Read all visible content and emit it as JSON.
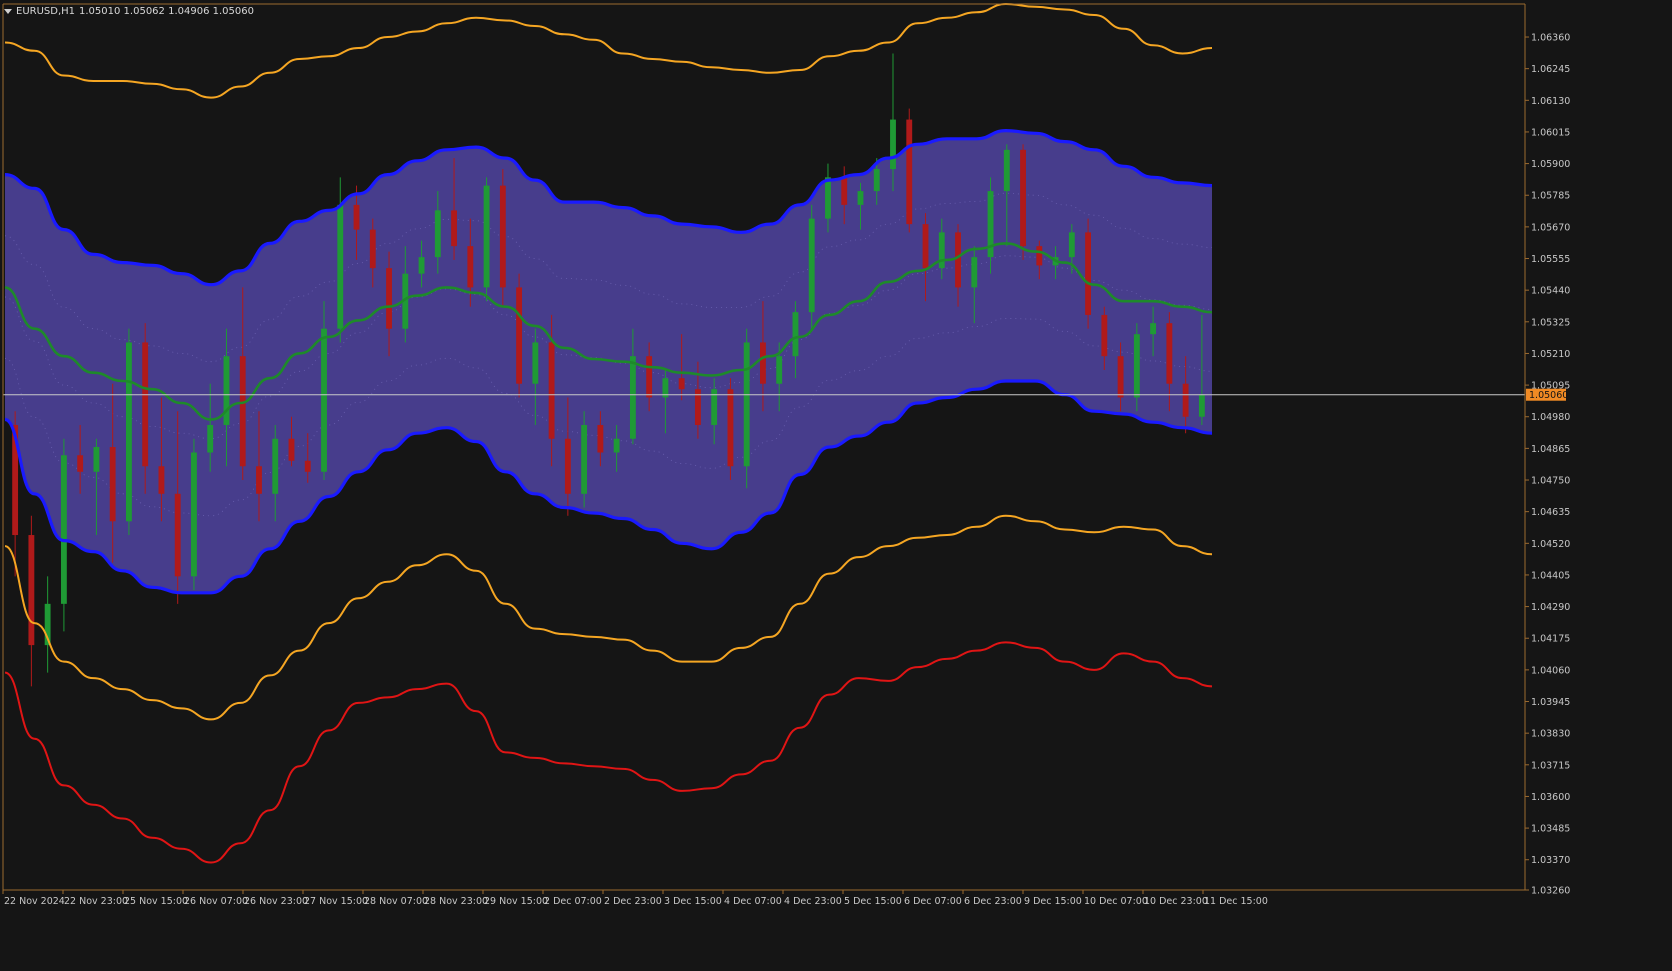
{
  "window": {
    "symbol_title": "EURUSD,H1",
    "ohlc": "1.05010 1.05062 1.04906 1.05060",
    "menu_icon": "triangle-down-icon"
  },
  "colors": {
    "background": "#151515",
    "band_fill": "#473d8c",
    "band_edge": "#1a1aff",
    "middle_line": "#1e8a2a",
    "outer_upper": "#f5a623",
    "lower_orange": "#f5a623",
    "lower_red": "#e01515",
    "bull_candle": "#1f9a35",
    "bear_candle": "#b01a1a",
    "price_line": "#c9c9c9",
    "axis": "#9c6a2f",
    "price_tag": "#f08a24"
  },
  "current_price": "1.05060",
  "chart_data": {
    "type": "line",
    "title": "EURUSD,H1",
    "ylim": [
      1.0326,
      1.0648
    ],
    "y_ticks": [
      "1.06360",
      "1.06245",
      "1.06130",
      "1.06015",
      "1.05900",
      "1.05785",
      "1.05670",
      "1.05555",
      "1.05440",
      "1.05325",
      "1.05210",
      "1.05095",
      "1.04980",
      "1.04865",
      "1.04750",
      "1.04635",
      "1.04520",
      "1.04405",
      "1.04290",
      "1.04175",
      "1.04060",
      "1.03945",
      "1.03830",
      "1.03715",
      "1.03600",
      "1.03485",
      "1.03370",
      "1.03260"
    ],
    "x_ticks": [
      "22 Nov 2024",
      "22 Nov 23:00",
      "25 Nov 15:00",
      "26 Nov 07:00",
      "26 Nov 23:00",
      "27 Nov 15:00",
      "28 Nov 07:00",
      "28 Nov 23:00",
      "29 Nov 15:00",
      "2 Dec 07:00",
      "2 Dec 23:00",
      "3 Dec 15:00",
      "4 Dec 07:00",
      "4 Dec 23:00",
      "5 Dec 15:00",
      "6 Dec 07:00",
      "6 Dec 23:00",
      "9 Dec 15:00",
      "10 Dec 07:00",
      "10 Dec 23:00",
      "11 Dec 15:00"
    ],
    "series": [
      {
        "role": "outer-upper",
        "values": [
          1.0634,
          1.0631,
          1.0622,
          1.062,
          1.062,
          1.0619,
          1.0617,
          1.0614,
          1.0618,
          1.0623,
          1.0628,
          1.0629,
          1.0632,
          1.0636,
          1.0638,
          1.0641,
          1.0643,
          1.0642,
          1.064,
          1.0637,
          1.0635,
          1.063,
          1.0628,
          1.0627,
          1.0625,
          1.0624,
          1.0623,
          1.0624,
          1.0629,
          1.0631,
          1.0634,
          1.0641,
          1.0643,
          1.0645,
          1.0648,
          1.0647,
          1.0646,
          1.0644,
          1.0639,
          1.0633,
          1.063,
          1.0632
        ]
      },
      {
        "role": "band-upper",
        "values": [
          1.0586,
          1.0581,
          1.0566,
          1.0557,
          1.0554,
          1.0553,
          1.055,
          1.0546,
          1.0551,
          1.0561,
          1.0569,
          1.0573,
          1.0579,
          1.0586,
          1.0591,
          1.0595,
          1.0596,
          1.0592,
          1.0584,
          1.0576,
          1.0576,
          1.0574,
          1.0571,
          1.0568,
          1.0567,
          1.0565,
          1.0568,
          1.0575,
          1.0584,
          1.0586,
          1.0592,
          1.0597,
          1.0599,
          1.0599,
          1.0602,
          1.0601,
          1.0598,
          1.0595,
          1.0589,
          1.0585,
          1.0583,
          1.0582
        ]
      },
      {
        "role": "middle",
        "values": [
          1.0545,
          1.053,
          1.052,
          1.0514,
          1.0511,
          1.0508,
          1.0503,
          1.0497,
          1.0503,
          1.0512,
          1.0521,
          1.0527,
          1.0533,
          1.0538,
          1.0542,
          1.0545,
          1.0543,
          1.0538,
          1.0531,
          1.0523,
          1.0519,
          1.0518,
          1.0516,
          1.0514,
          1.0513,
          1.0515,
          1.052,
          1.0527,
          1.0535,
          1.054,
          1.0547,
          1.0551,
          1.0555,
          1.0559,
          1.0561,
          1.0558,
          1.0554,
          1.0546,
          1.054,
          1.054,
          1.0538,
          1.0536
        ]
      },
      {
        "role": "band-lower",
        "values": [
          1.0497,
          1.047,
          1.0453,
          1.0449,
          1.0442,
          1.0436,
          1.0434,
          1.0434,
          1.044,
          1.045,
          1.046,
          1.0469,
          1.0478,
          1.0486,
          1.0492,
          1.0494,
          1.0489,
          1.0478,
          1.047,
          1.0465,
          1.0463,
          1.0461,
          1.0457,
          1.0452,
          1.045,
          1.0456,
          1.0463,
          1.0477,
          1.0487,
          1.0491,
          1.0496,
          1.0503,
          1.0505,
          1.0508,
          1.0511,
          1.0511,
          1.0506,
          1.05,
          1.0499,
          1.0496,
          1.0494,
          1.0492
        ]
      },
      {
        "role": "outer-lower",
        "values": [
          1.0451,
          1.0423,
          1.0409,
          1.0403,
          1.0399,
          1.0395,
          1.0392,
          1.0388,
          1.0394,
          1.0404,
          1.0413,
          1.0423,
          1.0432,
          1.0438,
          1.0444,
          1.0448,
          1.0442,
          1.043,
          1.0421,
          1.0419,
          1.0418,
          1.0417,
          1.0413,
          1.0409,
          1.0409,
          1.0414,
          1.0418,
          1.043,
          1.0441,
          1.0447,
          1.0451,
          1.0454,
          1.0455,
          1.0458,
          1.0462,
          1.046,
          1.0457,
          1.0456,
          1.0458,
          1.0457,
          1.0451,
          1.0448
        ]
      },
      {
        "role": "outer-lower-2",
        "values": [
          1.0405,
          1.0381,
          1.0364,
          1.0357,
          1.0352,
          1.0345,
          1.0341,
          1.0336,
          1.0343,
          1.0355,
          1.0371,
          1.0384,
          1.0394,
          1.0396,
          1.0399,
          1.0401,
          1.0391,
          1.0376,
          1.0374,
          1.0372,
          1.0371,
          1.037,
          1.0366,
          1.0362,
          1.0363,
          1.0368,
          1.0373,
          1.0385,
          1.0397,
          1.0403,
          1.0402,
          1.0407,
          1.041,
          1.0413,
          1.0416,
          1.0414,
          1.0409,
          1.0406,
          1.0412,
          1.0409,
          1.0403,
          1.04
        ]
      }
    ],
    "candles": [
      {
        "o": 1.0495,
        "h": 1.05,
        "l": 1.044,
        "c": 1.0455
      },
      {
        "o": 1.0455,
        "h": 1.0462,
        "l": 1.04,
        "c": 1.0415
      },
      {
        "o": 1.0415,
        "h": 1.044,
        "l": 1.0405,
        "c": 1.043
      },
      {
        "o": 1.043,
        "h": 1.049,
        "l": 1.042,
        "c": 1.0484
      },
      {
        "o": 1.0484,
        "h": 1.0495,
        "l": 1.047,
        "c": 1.0478
      },
      {
        "o": 1.0478,
        "h": 1.049,
        "l": 1.0455,
        "c": 1.0487
      },
      {
        "o": 1.0487,
        "h": 1.051,
        "l": 1.0445,
        "c": 1.046
      },
      {
        "o": 1.046,
        "h": 1.053,
        "l": 1.0455,
        "c": 1.0525
      },
      {
        "o": 1.0525,
        "h": 1.0532,
        "l": 1.047,
        "c": 1.048
      },
      {
        "o": 1.048,
        "h": 1.0505,
        "l": 1.046,
        "c": 1.047
      },
      {
        "o": 1.047,
        "h": 1.05,
        "l": 1.043,
        "c": 1.044
      },
      {
        "o": 1.044,
        "h": 1.049,
        "l": 1.0435,
        "c": 1.0485
      },
      {
        "o": 1.0485,
        "h": 1.051,
        "l": 1.0478,
        "c": 1.0495
      },
      {
        "o": 1.0495,
        "h": 1.053,
        "l": 1.048,
        "c": 1.052
      },
      {
        "o": 1.052,
        "h": 1.0545,
        "l": 1.0475,
        "c": 1.048
      },
      {
        "o": 1.048,
        "h": 1.05,
        "l": 1.046,
        "c": 1.047
      },
      {
        "o": 1.047,
        "h": 1.0495,
        "l": 1.046,
        "c": 1.049
      },
      {
        "o": 1.049,
        "h": 1.0498,
        "l": 1.048,
        "c": 1.0482
      },
      {
        "o": 1.0482,
        "h": 1.0492,
        "l": 1.0474,
        "c": 1.0478
      },
      {
        "o": 1.0478,
        "h": 1.054,
        "l": 1.0475,
        "c": 1.053
      },
      {
        "o": 1.053,
        "h": 1.0585,
        "l": 1.0525,
        "c": 1.0575
      },
      {
        "o": 1.0575,
        "h": 1.0582,
        "l": 1.0555,
        "c": 1.0566
      },
      {
        "o": 1.0566,
        "h": 1.057,
        "l": 1.0545,
        "c": 1.0552
      },
      {
        "o": 1.0552,
        "h": 1.0558,
        "l": 1.052,
        "c": 1.053
      },
      {
        "o": 1.053,
        "h": 1.056,
        "l": 1.0525,
        "c": 1.055
      },
      {
        "o": 1.055,
        "h": 1.0562,
        "l": 1.0545,
        "c": 1.0556
      },
      {
        "o": 1.0556,
        "h": 1.058,
        "l": 1.055,
        "c": 1.0573
      },
      {
        "o": 1.0573,
        "h": 1.0592,
        "l": 1.0555,
        "c": 1.056
      },
      {
        "o": 1.056,
        "h": 1.057,
        "l": 1.0538,
        "c": 1.0545
      },
      {
        "o": 1.0545,
        "h": 1.0585,
        "l": 1.054,
        "c": 1.0582
      },
      {
        "o": 1.0582,
        "h": 1.0588,
        "l": 1.0538,
        "c": 1.0545
      },
      {
        "o": 1.0545,
        "h": 1.055,
        "l": 1.0505,
        "c": 1.051
      },
      {
        "o": 1.051,
        "h": 1.053,
        "l": 1.0495,
        "c": 1.0525
      },
      {
        "o": 1.0525,
        "h": 1.0535,
        "l": 1.048,
        "c": 1.049
      },
      {
        "o": 1.049,
        "h": 1.0505,
        "l": 1.0462,
        "c": 1.047
      },
      {
        "o": 1.047,
        "h": 1.05,
        "l": 1.0465,
        "c": 1.0495
      },
      {
        "o": 1.0495,
        "h": 1.05,
        "l": 1.048,
        "c": 1.0485
      },
      {
        "o": 1.0485,
        "h": 1.0495,
        "l": 1.0478,
        "c": 1.049
      },
      {
        "o": 1.049,
        "h": 1.053,
        "l": 1.0488,
        "c": 1.052
      },
      {
        "o": 1.052,
        "h": 1.0525,
        "l": 1.05,
        "c": 1.0505
      },
      {
        "o": 1.0505,
        "h": 1.0515,
        "l": 1.0492,
        "c": 1.0512
      },
      {
        "o": 1.0512,
        "h": 1.0528,
        "l": 1.0504,
        "c": 1.0508
      },
      {
        "o": 1.0508,
        "h": 1.0518,
        "l": 1.049,
        "c": 1.0495
      },
      {
        "o": 1.0495,
        "h": 1.0512,
        "l": 1.0488,
        "c": 1.0508
      },
      {
        "o": 1.0508,
        "h": 1.0512,
        "l": 1.0475,
        "c": 1.048
      },
      {
        "o": 1.048,
        "h": 1.053,
        "l": 1.0472,
        "c": 1.0525
      },
      {
        "o": 1.0525,
        "h": 1.054,
        "l": 1.05,
        "c": 1.051
      },
      {
        "o": 1.051,
        "h": 1.0525,
        "l": 1.05,
        "c": 1.052
      },
      {
        "o": 1.052,
        "h": 1.054,
        "l": 1.0512,
        "c": 1.0536
      },
      {
        "o": 1.0536,
        "h": 1.0575,
        "l": 1.053,
        "c": 1.057
      },
      {
        "o": 1.057,
        "h": 1.059,
        "l": 1.0565,
        "c": 1.0585
      },
      {
        "o": 1.0585,
        "h": 1.0589,
        "l": 1.0568,
        "c": 1.0575
      },
      {
        "o": 1.0575,
        "h": 1.0583,
        "l": 1.0566,
        "c": 1.058
      },
      {
        "o": 1.058,
        "h": 1.0592,
        "l": 1.0575,
        "c": 1.0588
      },
      {
        "o": 1.0588,
        "h": 1.063,
        "l": 1.058,
        "c": 1.0606
      },
      {
        "o": 1.0606,
        "h": 1.061,
        "l": 1.0565,
        "c": 1.0568
      },
      {
        "o": 1.0568,
        "h": 1.0572,
        "l": 1.054,
        "c": 1.0552
      },
      {
        "o": 1.0552,
        "h": 1.057,
        "l": 1.0548,
        "c": 1.0565
      },
      {
        "o": 1.0565,
        "h": 1.0568,
        "l": 1.0538,
        "c": 1.0545
      },
      {
        "o": 1.0545,
        "h": 1.056,
        "l": 1.0532,
        "c": 1.0556
      },
      {
        "o": 1.0556,
        "h": 1.0585,
        "l": 1.055,
        "c": 1.058
      },
      {
        "o": 1.058,
        "h": 1.0597,
        "l": 1.056,
        "c": 1.0595
      },
      {
        "o": 1.0595,
        "h": 1.0597,
        "l": 1.0555,
        "c": 1.056
      },
      {
        "o": 1.056,
        "h": 1.0562,
        "l": 1.0548,
        "c": 1.0553
      },
      {
        "o": 1.0553,
        "h": 1.056,
        "l": 1.0548,
        "c": 1.0556
      },
      {
        "o": 1.0556,
        "h": 1.0568,
        "l": 1.055,
        "c": 1.0565
      },
      {
        "o": 1.0565,
        "h": 1.057,
        "l": 1.053,
        "c": 1.0535
      },
      {
        "o": 1.0535,
        "h": 1.0538,
        "l": 1.0515,
        "c": 1.052
      },
      {
        "o": 1.052,
        "h": 1.0525,
        "l": 1.05,
        "c": 1.0505
      },
      {
        "o": 1.0505,
        "h": 1.0532,
        "l": 1.05,
        "c": 1.0528
      },
      {
        "o": 1.0528,
        "h": 1.0538,
        "l": 1.052,
        "c": 1.0532
      },
      {
        "o": 1.0532,
        "h": 1.0536,
        "l": 1.05,
        "c": 1.051
      },
      {
        "o": 1.051,
        "h": 1.052,
        "l": 1.0492,
        "c": 1.0498
      },
      {
        "o": 1.0498,
        "h": 1.0535,
        "l": 1.0495,
        "c": 1.0506
      }
    ]
  },
  "footer": {
    "date_labels": [
      "22 Nov 2024",
      "22 Nov 23:00",
      "25 Nov 15:00",
      "26 Nov 07:00",
      "26 Nov 23:00",
      "27 Nov 15:00",
      "28 Nov 07:00",
      "28 Nov 23:00",
      "29 Nov 15:00",
      "2 Dec 07:00",
      "2 Dec 23:00",
      "3 Dec 15:00",
      "4 Dec 07:00",
      "4 Dec 23:00",
      "5 Dec 15:00",
      "6 Dec 07:00",
      "6 Dec 23:00",
      "9 Dec 15:00",
      "10 Dec 07:00",
      "10 Dec 23:00",
      "11 Dec 15:00"
    ]
  }
}
